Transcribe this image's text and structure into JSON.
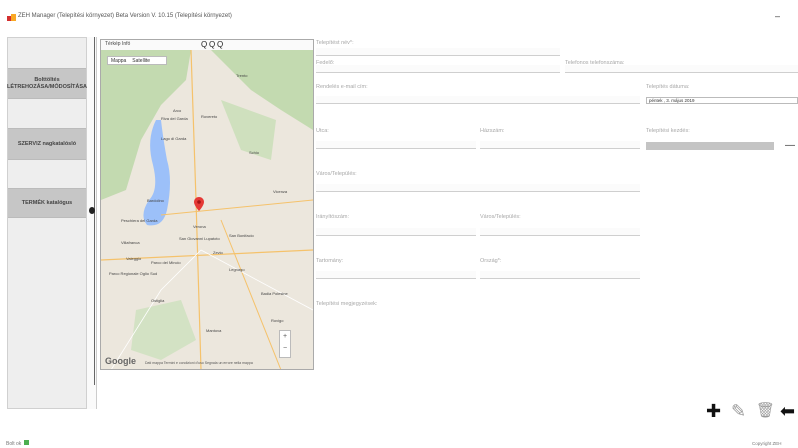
{
  "window": {
    "title": "ZEH Manager  (Telepítési környezet) Beta Version  V. 10.15  (Telepítési környezet)",
    "minimize_glyph": "–"
  },
  "sidebar": {
    "items": [
      {
        "label": "Bolttöltés LÉTREHOZÁSA/MÓDOSÍTÁSA"
      },
      {
        "label": "SZERVIZ nagkatalósló"
      },
      {
        "label": "TERMÉK katalógus"
      }
    ]
  },
  "map": {
    "toolbar_label": "Térkép  Infó",
    "zoom_icons": [
      "Q",
      "Q",
      "Q"
    ],
    "type_options": [
      "Mappa",
      "Satellite"
    ],
    "place_labels": [
      "Trento",
      "Riva del Garda",
      "Rovereto",
      "Arco",
      "Lago di Garda",
      "Schio",
      "Vicenza",
      "Bardolino",
      "Peschiera del Garda",
      "Verona",
      "San Giovanni Lupatoto",
      "San Bonifacio",
      "Villafranca",
      "Valeggio",
      "Mantova",
      "Legnago",
      "Parco del Mincio",
      "Parco Regionale Oglio Sud",
      "Ostiglia",
      "Badia Polesine",
      "Rovigo",
      "Zevio"
    ],
    "logo": "Google",
    "footer": "Dati mappa  Termini e condizioni d'uso  Segnala un errore nella mappa"
  },
  "form": {
    "installer_name_label": "Telepítést név*:",
    "company_label": "Fedelő:",
    "phone_label": "Telefonos telefonszáma:",
    "email_label": "Rendelés e-mail cím:",
    "install_date_label": "Telepítés dátuma:",
    "install_date_value": "péntek  ,  3.  május  2019",
    "street_label": "Utca:",
    "house_no_label": "Házszám:",
    "install_image_label": "Telepítési kezdés:",
    "city_label": "Város/Település:",
    "zip_label": "Irányítószám:",
    "city2_label": "Város/Település:",
    "county_label": "Tartomány:",
    "country_label": "Ország*:",
    "notes_label": "Telepítési megjegyzések:",
    "image_remove_glyph": "—"
  },
  "toolbar": {
    "add_glyph": "✚",
    "edit_glyph": "✎",
    "delete_glyph": "🗑",
    "back_glyph": "⬅"
  },
  "footer": {
    "left": "Bolt ok",
    "right": "Copyright ZEH"
  },
  "colors": {
    "sidebar_button": "#c6c6c6",
    "map_water": "#9cc0f9",
    "map_green": "#b9d7a5",
    "marker": "#e53935",
    "footer_accent": "#c0392b"
  }
}
